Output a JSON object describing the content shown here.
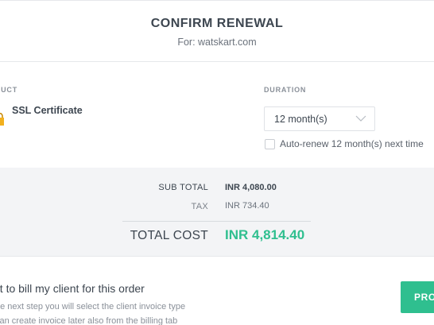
{
  "header": {
    "title": "CONFIRM RENEWAL",
    "subtitle": "For: watskart.com"
  },
  "order": {
    "product_label": "ODUCT",
    "duration_label": "DURATION",
    "product_name": "SSL Certificate",
    "product_icon": "lock-icon",
    "duration_value": "12 month(s)",
    "auto_renew_label": "Auto-renew 12 month(s) next time",
    "auto_renew_checked": false
  },
  "totals": {
    "sub_total_label": "SUB TOTAL",
    "sub_total_value": "INR 4,080.00",
    "tax_label": "TAX",
    "tax_value": "INR 734.40",
    "total_label": "TOTAL COST",
    "total_value": "INR 4,814.40"
  },
  "billing": {
    "title": "nt to bill my client for this order",
    "line1": "he next step you will select the client invoice type",
    "line2": "can create invoice later also from the billing tab",
    "proceed_label": "PRO"
  },
  "colors": {
    "accent": "#2fbf8f",
    "panel": "#f3f4f6",
    "text": "#3d4650"
  }
}
